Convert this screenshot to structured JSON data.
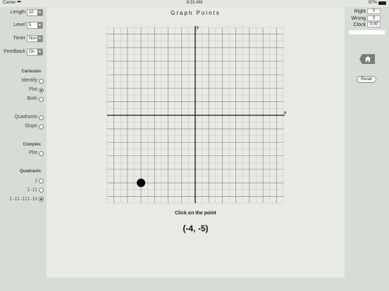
{
  "status_bar": {
    "carrier": "Carrier",
    "time": "6:31 AM",
    "battery": "97%"
  },
  "sidebar": {
    "controls": [
      {
        "label": "Length",
        "value": "10"
      },
      {
        "label": "Level",
        "value": "5"
      },
      {
        "label": "Timer",
        "value": "Non"
      },
      {
        "label": "Feedback",
        "value": "On"
      }
    ],
    "cartesian": {
      "header": "Cartesian",
      "options": [
        {
          "label": "Identify",
          "selected": false
        },
        {
          "label": "Plot",
          "selected": true
        },
        {
          "label": "Both",
          "selected": false
        }
      ]
    },
    "extra_options": [
      {
        "label": "Quadrants",
        "selected": false
      },
      {
        "label": "Slope",
        "selected": false
      }
    ],
    "complex": {
      "header": "Complex",
      "options": [
        {
          "label": "Plot",
          "selected": false
        }
      ]
    },
    "quadrants": {
      "header": "Quadrants",
      "options": [
        {
          "label": "I",
          "selected": false
        },
        {
          "label": "I-II",
          "selected": false
        },
        {
          "label": "I-II-III-IV",
          "selected": true
        }
      ]
    }
  },
  "main": {
    "title": "Graph Points",
    "instruction": "Click on the point",
    "target_point": "(-4, -5)",
    "graph": {
      "x_label": "x",
      "y_label": "y",
      "x_range": [
        -6.5,
        6.5
      ],
      "y_range": [
        -6.5,
        6.5
      ],
      "marked_point": {
        "x": -4,
        "y": -5
      }
    }
  },
  "right_panel": {
    "right_label": "Right",
    "right_value": "0",
    "wrong_label": "Wrong",
    "wrong_value": "0",
    "clock_label": "Clock",
    "clock_value": "0:00",
    "progress_fraction": 0,
    "reset_label": "Reset"
  }
}
